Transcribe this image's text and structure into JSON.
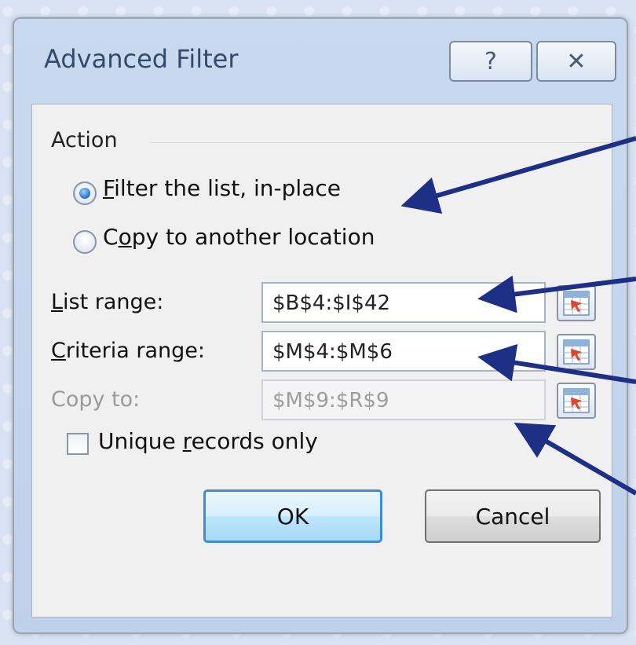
{
  "dialog": {
    "title": "Advanced Filter",
    "help_glyph": "?",
    "close_glyph": "✕"
  },
  "action": {
    "group_label": "Action",
    "options": [
      {
        "label_pre": "",
        "accel": "F",
        "label_post": "ilter the list, in-place",
        "checked": true
      },
      {
        "label_pre": "C",
        "accel": "o",
        "label_post": "py to another location",
        "checked": false
      }
    ]
  },
  "fields": {
    "list_range": {
      "label_accel": "L",
      "label_rest": "ist range:",
      "value": "$B$4:$I$42",
      "enabled": true
    },
    "criteria_range": {
      "label_accel": "C",
      "label_rest": "riteria range:",
      "value": "$M$4:$M$6",
      "enabled": true
    },
    "copy_to": {
      "label": "Copy to:",
      "value": "$M$9:$R$9",
      "enabled": false
    }
  },
  "unique": {
    "label_pre": "Unique ",
    "accel": "r",
    "label_post": "ecords only",
    "checked": false
  },
  "buttons": {
    "ok": "OK",
    "cancel": "Cancel"
  },
  "colors": {
    "arrow": "#1e2f86",
    "default_button_border": "#3c8cd6"
  }
}
